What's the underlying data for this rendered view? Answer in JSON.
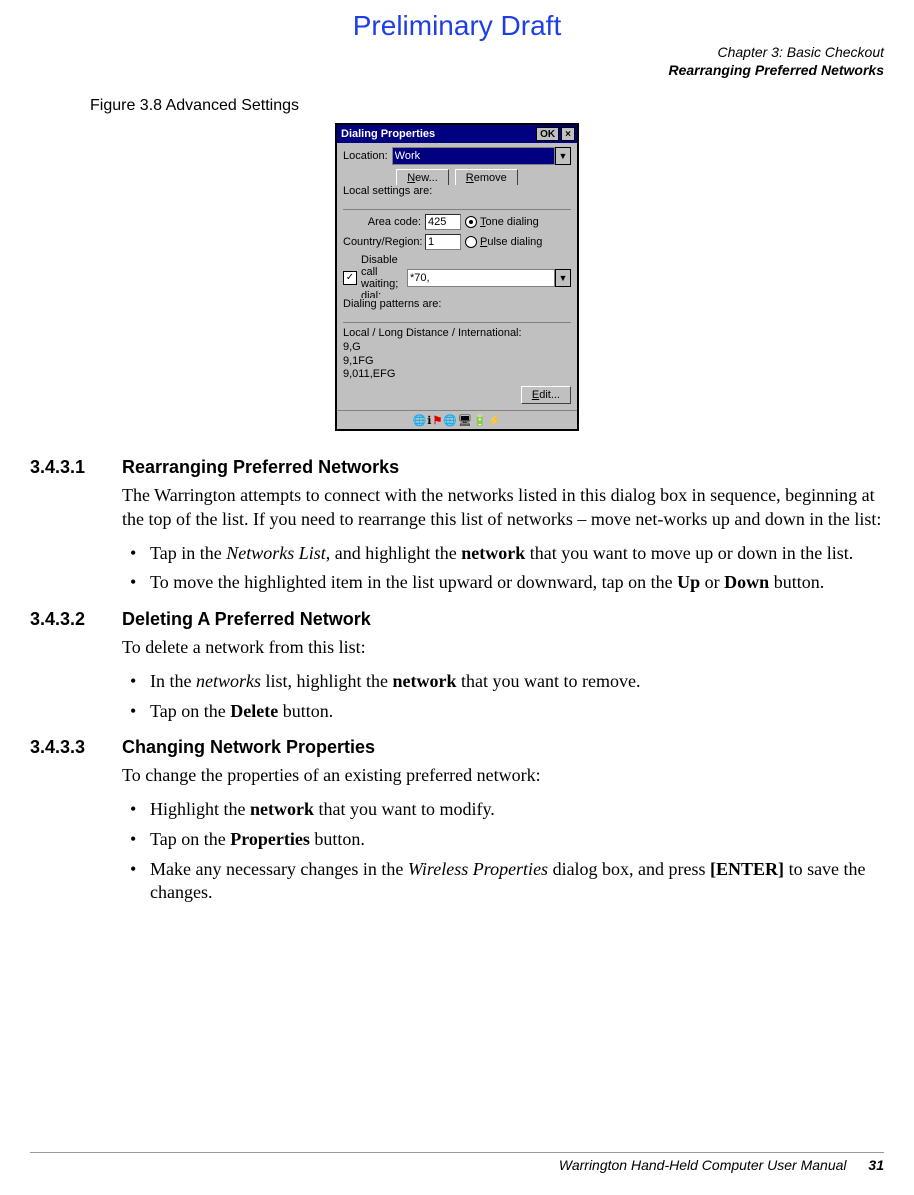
{
  "draft_banner": "Preliminary Draft",
  "chapter_header": {
    "line1": "Chapter 3: Basic Checkout",
    "line2": "Rearranging Preferred Networks"
  },
  "figure_caption": "Figure 3.8  Advanced Settings",
  "dialog": {
    "title": "Dialing Properties",
    "ok": "OK",
    "close": "×",
    "location_label": "Location:",
    "location_value": "Work",
    "new_btn": "New...",
    "remove_btn": "Remove",
    "local_settings_label": "Local settings are:",
    "area_code_label": "Area code:",
    "area_code_value": "425",
    "country_label": "Country/Region:",
    "country_value": "1",
    "tone_label": "Tone dialing",
    "pulse_label": "Pulse dialing",
    "disable_cw_label": "Disable call waiting; dial:",
    "disable_cw_value": "*70,",
    "patterns_label": "Dialing patterns are:",
    "patterns_sub": "Local / Long Distance / International:",
    "pattern1": "9,G",
    "pattern2": "9,1FG",
    "pattern3": "9,011,EFG",
    "edit_btn": "Edit..."
  },
  "sections": {
    "s1": {
      "num": "3.4.3.1",
      "title": "Rearranging Preferred Networks",
      "intro": "The Warrington attempts to connect with the networks listed in this dialog box in sequence, beginning at the top of the list. If you need to rearrange this list of networks – move net-works up and down in the list:",
      "b1_pre": "Tap in the ",
      "b1_italic": "Networks List",
      "b1_mid": ", and highlight the ",
      "b1_bold": "network",
      "b1_post": " that you want to move up or down in the list.",
      "b2_pre": "To move the highlighted item in the list upward or downward, tap on the ",
      "b2_bold1": "Up",
      "b2_mid": " or ",
      "b2_bold2": "Down",
      "b2_post": " button."
    },
    "s2": {
      "num": "3.4.3.2",
      "title": "Deleting A Preferred Network",
      "intro": "To delete a network from this list:",
      "b1_pre": "In the ",
      "b1_italic": "networks",
      "b1_mid": " list, highlight the ",
      "b1_bold": "network",
      "b1_post": " that you want to remove.",
      "b2_pre": "Tap on the ",
      "b2_bold": "Delete",
      "b2_post": " button."
    },
    "s3": {
      "num": "3.4.3.3",
      "title": "Changing Network Properties",
      "intro": "To change the properties of an existing preferred network:",
      "b1_pre": "Highlight the ",
      "b1_bold": "network",
      "b1_post": " that you want to modify.",
      "b2_pre": "Tap on the ",
      "b2_bold": "Properties",
      "b2_post": " button.",
      "b3_pre": "Make any necessary changes in the ",
      "b3_italic": "Wireless Properties",
      "b3_mid": " dialog box, and press ",
      "b3_bold": "[ENTER]",
      "b3_post": " to save the changes."
    }
  },
  "footer": {
    "text": "Warrington Hand-Held Computer User Manual",
    "page": "31"
  }
}
